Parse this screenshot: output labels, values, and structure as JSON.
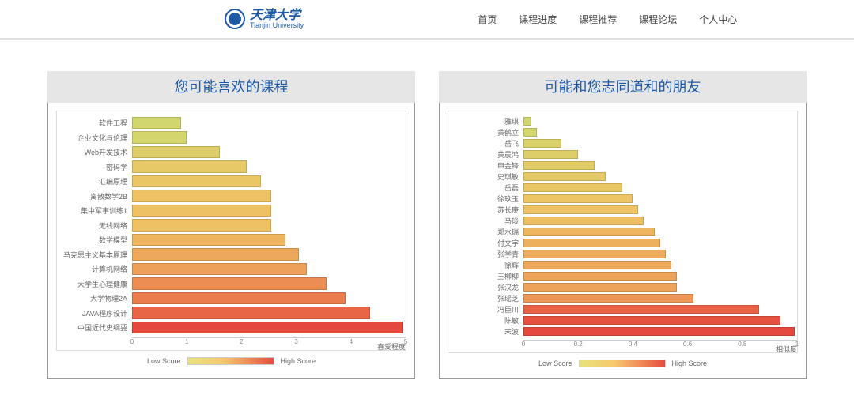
{
  "brand": {
    "cn": "天津大学",
    "en": "Tianjin University"
  },
  "nav": {
    "items": [
      "首页",
      "课程进度",
      "课程推荐",
      "课程论坛",
      "个人中心"
    ]
  },
  "legend": {
    "low": "Low Score",
    "high": "High Score"
  },
  "cards": [
    {
      "title": "您可能喜欢的课程"
    },
    {
      "title": "可能和您志同道和的朋友"
    }
  ],
  "chart_data": [
    {
      "type": "bar",
      "orientation": "horizontal",
      "title": "您可能喜欢的课程",
      "xlabel": "喜爱程度",
      "xlim": [
        0,
        5
      ],
      "ticks": [
        0,
        1,
        2,
        3,
        4,
        5
      ],
      "categories": [
        "软件工程",
        "企业文化与伦理",
        "Web开发技术",
        "密码学",
        "汇编原理",
        "离散数学2B",
        "集中军事训练1",
        "无线网络",
        "数学模型",
        "马克思主义基本原理",
        "计算机网络",
        "大学生心理健康",
        "大学物理2A",
        "JAVA程序设计",
        "中国近代史纲要"
      ],
      "values": [
        0.9,
        1.0,
        1.6,
        2.1,
        2.35,
        2.55,
        2.55,
        2.55,
        2.8,
        3.05,
        3.2,
        3.55,
        3.9,
        4.35,
        4.95
      ],
      "colormap": "low-high"
    },
    {
      "type": "bar",
      "orientation": "horizontal",
      "title": "可能和您志同道和的朋友",
      "xlabel": "相似度",
      "xlim": [
        0,
        1
      ],
      "ticks": [
        0,
        0.2,
        0.4,
        0.6,
        0.8,
        1.0
      ],
      "categories": [
        "雅琪",
        "黄鹤立",
        "岳飞",
        "黄晨鸿",
        "申金锋",
        "史琪敏",
        "岳磊",
        "徐玖玉",
        "苏长庚",
        "马琰",
        "郑水瑞",
        "付文宇",
        "张学青",
        "徐辉",
        "王柳柳",
        "张汉龙",
        "张瑶芝",
        "冯臣川",
        "陈敏",
        "宋波"
      ],
      "values": [
        0.03,
        0.05,
        0.14,
        0.2,
        0.26,
        0.3,
        0.36,
        0.4,
        0.42,
        0.44,
        0.48,
        0.5,
        0.52,
        0.54,
        0.56,
        0.56,
        0.62,
        0.86,
        0.94,
        0.99
      ],
      "colormap": "low-high"
    }
  ]
}
